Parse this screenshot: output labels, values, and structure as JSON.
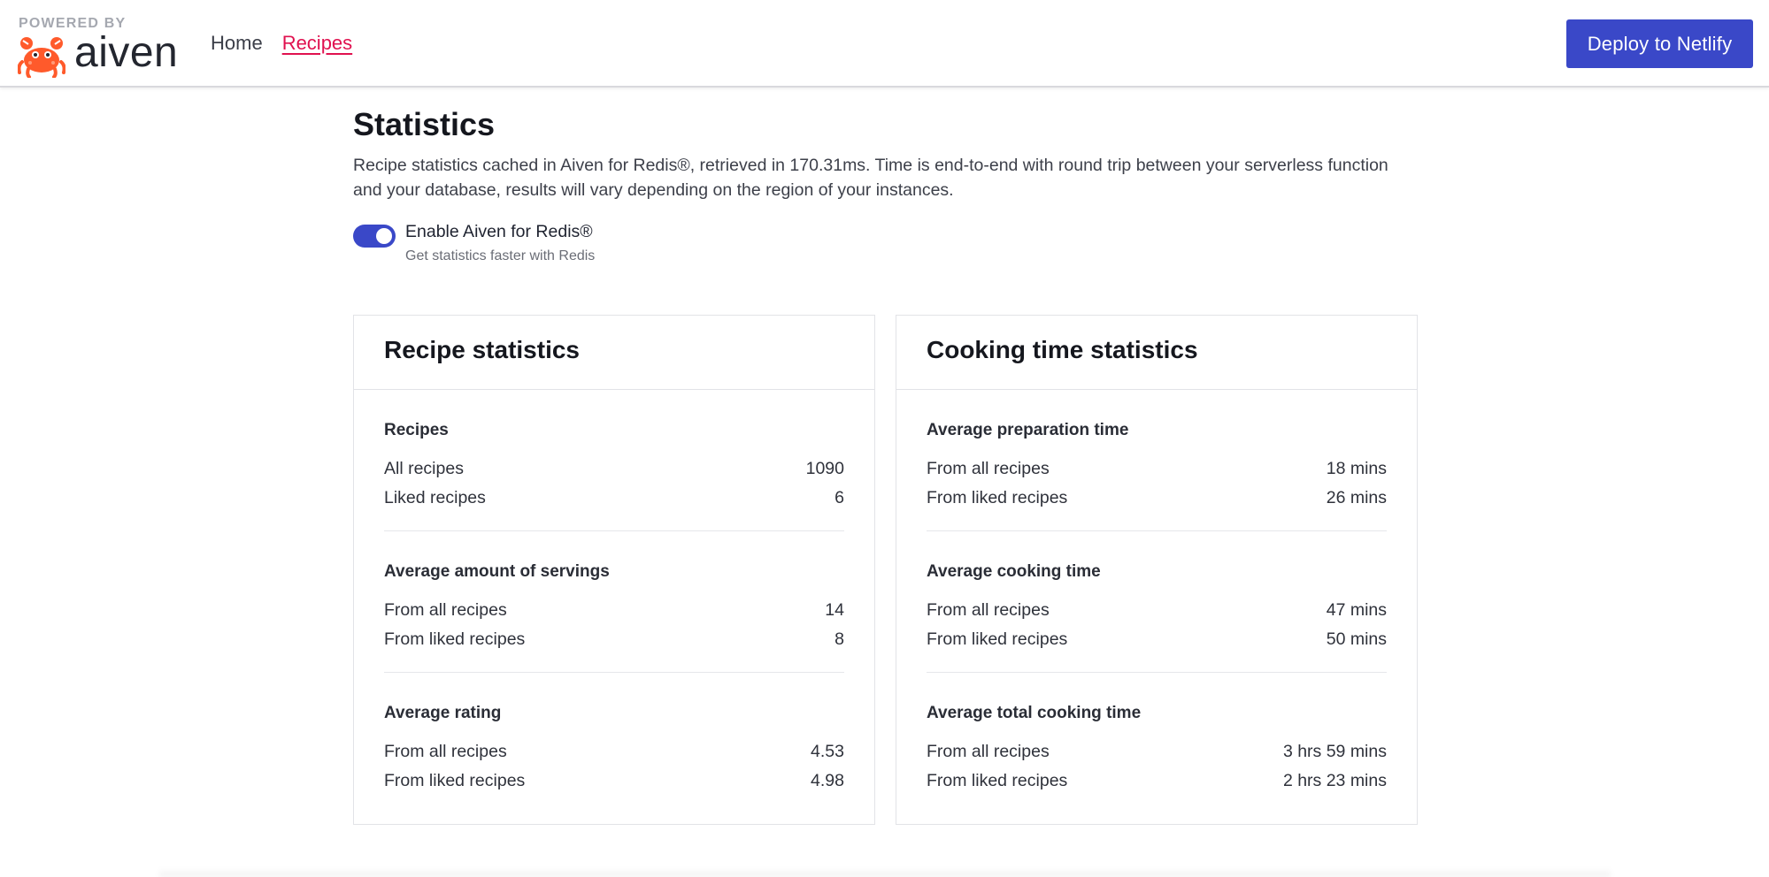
{
  "header": {
    "powered_by": "POWERED BY",
    "brand_name": "aiven",
    "nav": [
      {
        "label": "Home",
        "active": false
      },
      {
        "label": "Recipes",
        "active": true
      }
    ],
    "deploy_label": "Deploy to Netlify"
  },
  "colors": {
    "accent": "#3a48c8",
    "nav_active": "#e0114f",
    "brand_crab": "#ff5a2b"
  },
  "page": {
    "title": "Statistics",
    "description": "Recipe statistics cached in Aiven for Redis®, retrieved in 170.31ms. Time is end-to-end with round trip between your serverless function and your database, results will vary depending on the region of your instances.",
    "toggle": {
      "label": "Enable Aiven for Redis®",
      "sublabel": "Get statistics faster with Redis",
      "enabled": true
    }
  },
  "cards": [
    {
      "title": "Recipe statistics",
      "sections": [
        {
          "title": "Recipes",
          "rows": [
            {
              "label": "All recipes",
              "value": "1090"
            },
            {
              "label": "Liked recipes",
              "value": "6"
            }
          ]
        },
        {
          "title": "Average amount of servings",
          "rows": [
            {
              "label": "From all recipes",
              "value": "14"
            },
            {
              "label": "From liked recipes",
              "value": "8"
            }
          ]
        },
        {
          "title": "Average rating",
          "rows": [
            {
              "label": "From all recipes",
              "value": "4.53"
            },
            {
              "label": "From liked recipes",
              "value": "4.98"
            }
          ]
        }
      ]
    },
    {
      "title": "Cooking time statistics",
      "sections": [
        {
          "title": "Average preparation time",
          "rows": [
            {
              "label": "From all recipes",
              "value": "18 mins"
            },
            {
              "label": "From liked recipes",
              "value": "26 mins"
            }
          ]
        },
        {
          "title": "Average cooking time",
          "rows": [
            {
              "label": "From all recipes",
              "value": "47 mins"
            },
            {
              "label": "From liked recipes",
              "value": "50 mins"
            }
          ]
        },
        {
          "title": "Average total cooking time",
          "rows": [
            {
              "label": "From all recipes",
              "value": "3 hrs 59 mins"
            },
            {
              "label": "From liked recipes",
              "value": "2 hrs 23 mins"
            }
          ]
        }
      ]
    }
  ]
}
